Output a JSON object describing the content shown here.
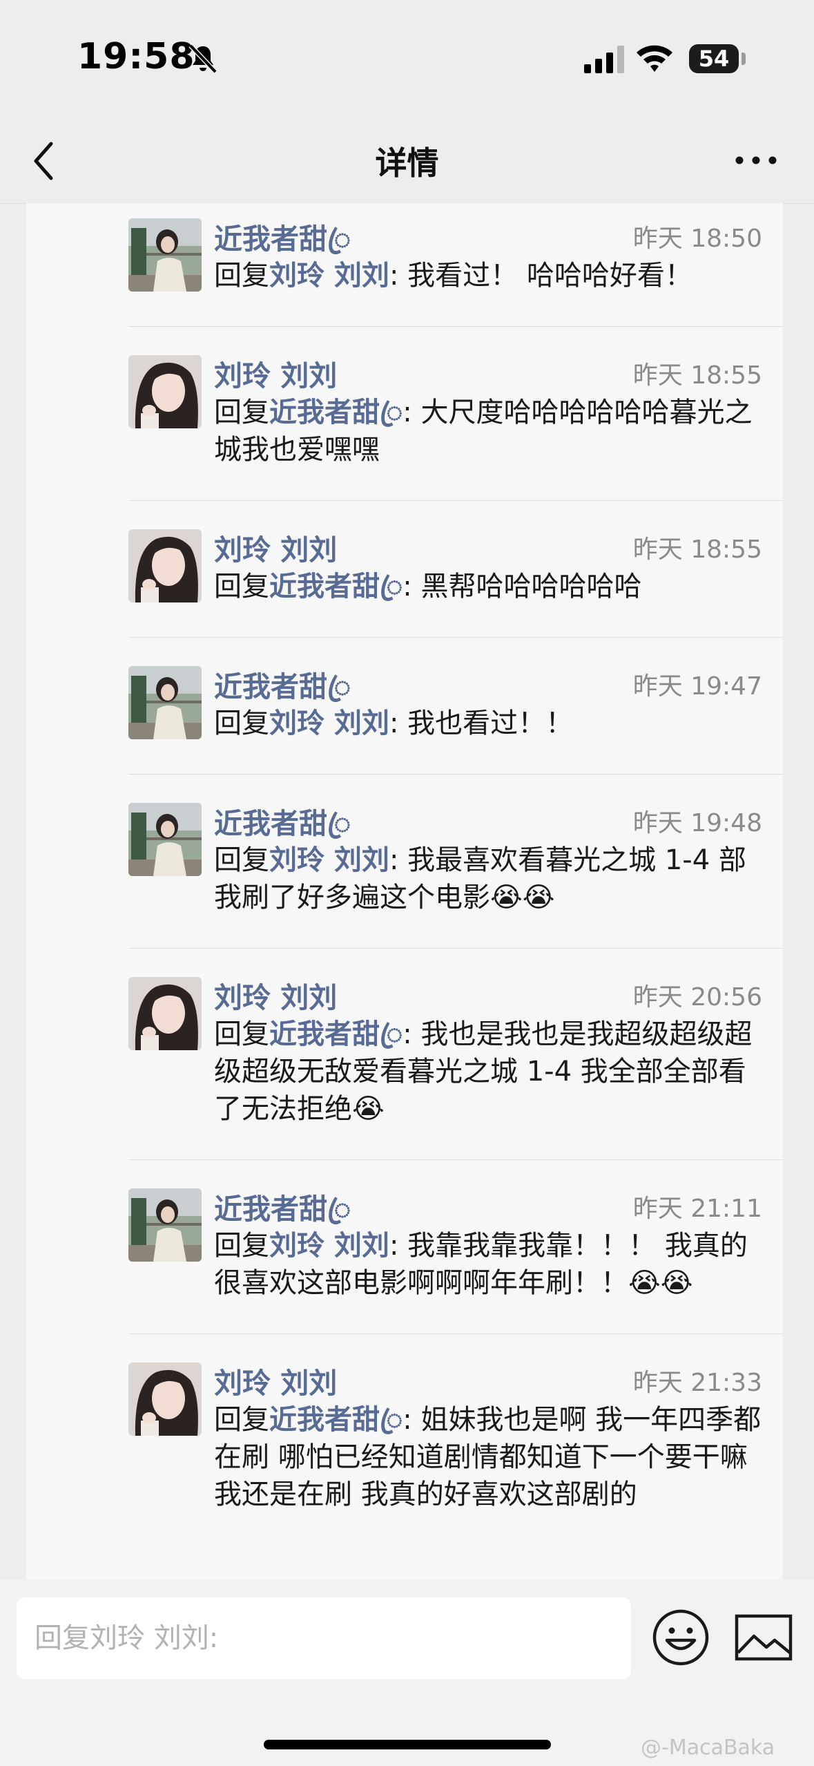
{
  "status_bar": {
    "time": "19:58",
    "battery": "54"
  },
  "nav": {
    "title": "详情"
  },
  "replies": [
    {
      "name": "近我者甜ꦿ",
      "time": "昨天 18:50",
      "prefix": "回复",
      "to": "刘玲 刘刘",
      "text": ": 我看过！ 哈哈哈好看！",
      "avatar": "avatar-1"
    },
    {
      "name": "刘玲 刘刘",
      "time": "昨天 18:55",
      "prefix": "回复",
      "to": "近我者甜ꦿ",
      "text": ": 大尺度哈哈哈哈哈哈暮光之城我也爱嘿嘿",
      "avatar": "avatar-2"
    },
    {
      "name": "刘玲 刘刘",
      "time": "昨天 18:55",
      "prefix": "回复",
      "to": "近我者甜ꦿ",
      "text": ": 黑帮哈哈哈哈哈哈",
      "avatar": "avatar-2"
    },
    {
      "name": "近我者甜ꦿ",
      "time": "昨天 19:47",
      "prefix": "回复",
      "to": "刘玲 刘刘",
      "text": ": 我也看过！！",
      "avatar": "avatar-1"
    },
    {
      "name": "近我者甜ꦿ",
      "time": "昨天 19:48",
      "prefix": "回复",
      "to": "刘玲 刘刘",
      "text": ": 我最喜欢看暮光之城 1-4 部 我刷了好多遍这个电影😭😭",
      "avatar": "avatar-1"
    },
    {
      "name": "刘玲 刘刘",
      "time": "昨天 20:56",
      "prefix": "回复",
      "to": "近我者甜ꦿ",
      "text": ": 我也是我也是我超级超级超级超级无敌爱看暮光之城 1-4 我全部全部看了无法拒绝😭",
      "avatar": "avatar-2"
    },
    {
      "name": "近我者甜ꦿ",
      "time": "昨天 21:11",
      "prefix": "回复",
      "to": "刘玲 刘刘",
      "text": ": 我靠我靠我靠！！！ 我真的很喜欢这部电影啊啊啊年年刷！！😭😭",
      "avatar": "avatar-1"
    },
    {
      "name": "刘玲 刘刘",
      "time": "昨天 21:33",
      "prefix": "回复",
      "to": "近我者甜ꦿ",
      "text": ": 姐妹我也是啊 我一年四季都在刷 哪怕已经知道剧情都知道下一个要干嘛 我还是在刷 我真的好喜欢这部剧的",
      "avatar": "avatar-2"
    }
  ],
  "input": {
    "placeholder": "回复刘玲 刘刘:"
  },
  "watermark": "@-MacaBaka",
  "icons": {
    "back": "chevron-left-icon",
    "more": "more-icon",
    "emoji": "emoji-icon",
    "image": "image-icon",
    "bell": "bell-off-icon",
    "signal": "signal-icon",
    "wifi": "wifi-icon"
  }
}
